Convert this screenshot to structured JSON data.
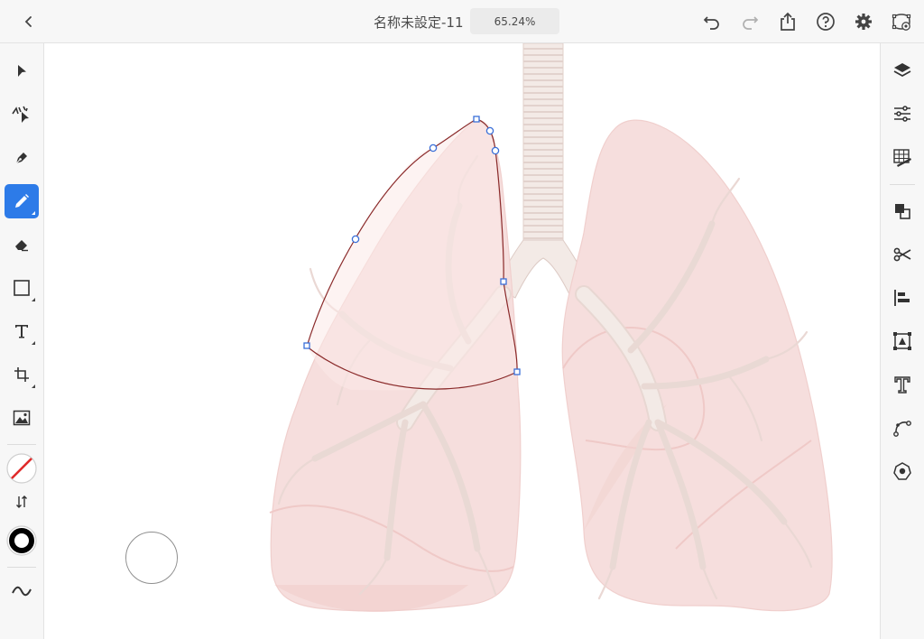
{
  "header": {
    "back_icon": "chevron-left-icon",
    "document_title": "名称未設定-11",
    "zoom_level": "65.24%",
    "icons": [
      "undo-icon",
      "redo-icon",
      "share-icon",
      "help-icon",
      "settings-icon",
      "touch-modifier-icon"
    ]
  },
  "left_toolbar": {
    "tools": [
      "selection-icon",
      "direct-selection-icon",
      "pen-icon",
      "pencil-icon",
      "eraser-icon",
      "rectangle-icon",
      "type-icon",
      "transform-icon",
      "place-image-icon"
    ],
    "active_tool": "pencil-icon",
    "fill_swatch": "none",
    "stroke_color": "#000000",
    "extra_icons": [
      "swap-fill-stroke-icon",
      "smooth-icon"
    ]
  },
  "right_toolbar": {
    "icons": [
      "layers-icon",
      "properties-icon",
      "grid-icon",
      "arrange-icon",
      "scissors-icon",
      "align-icon",
      "crop-icon",
      "type-settings-icon",
      "path-icon",
      "symbol-icon"
    ]
  },
  "colors": {
    "accent": "#2d7be8",
    "lung_fill": "#f6dedd",
    "lung_shadow": "#efc9c7",
    "trachea": "#f1e6e2",
    "path_stroke": "#8a2a2a",
    "anchor_stroke": "#3a6fd8"
  }
}
